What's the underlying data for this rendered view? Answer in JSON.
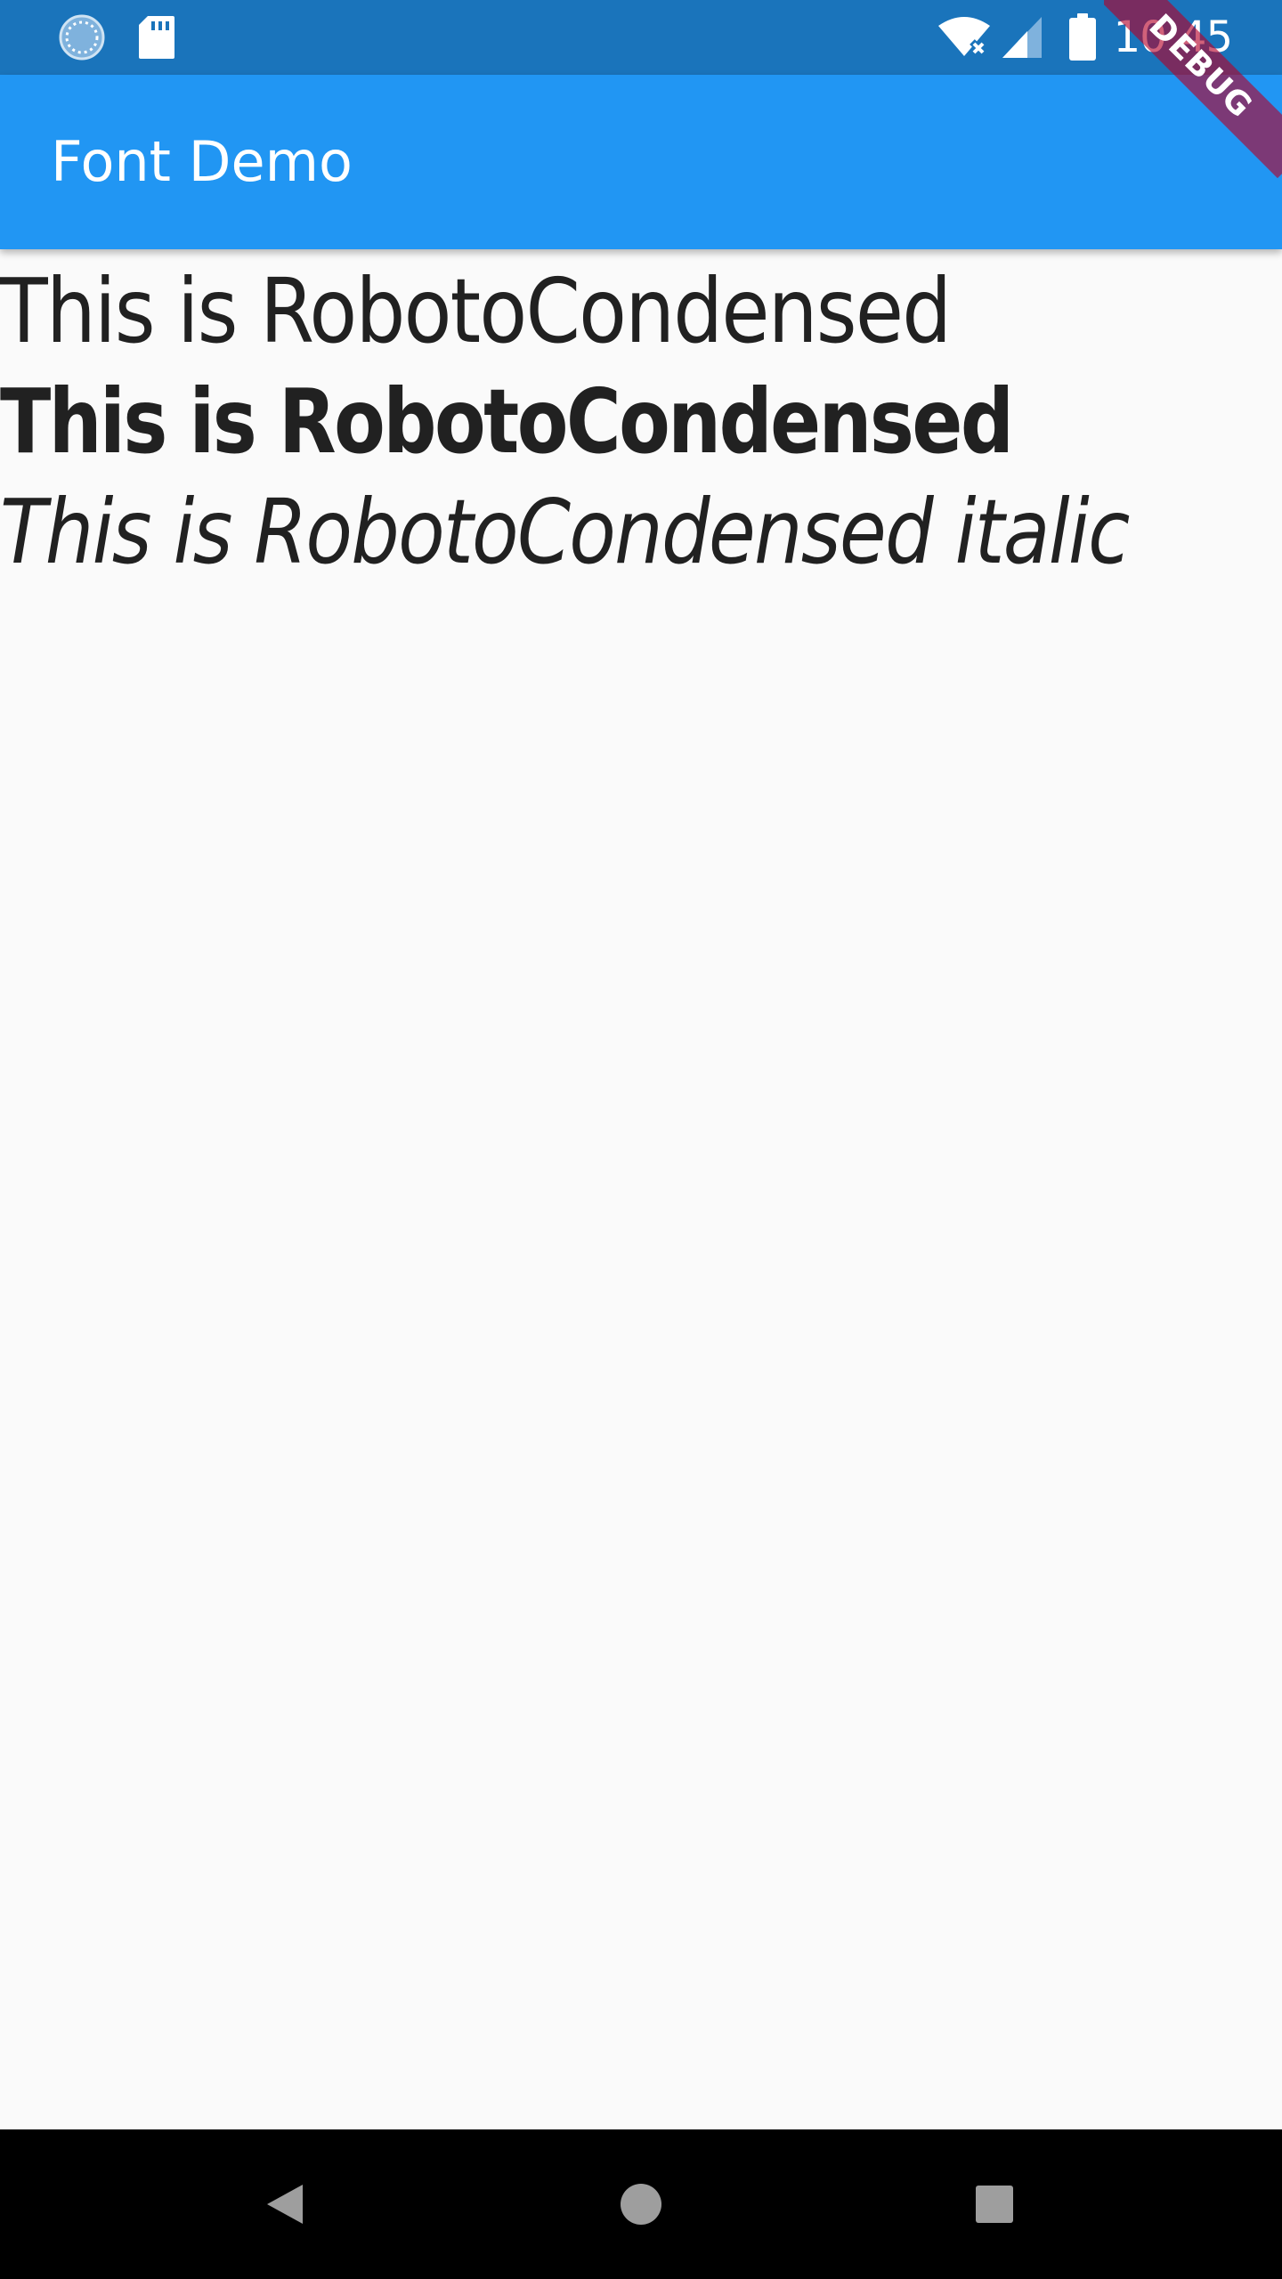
{
  "status_bar": {
    "time": "10:45",
    "left_icons": [
      "sync-icon",
      "sd-card-icon"
    ],
    "right_icons": [
      "wifi-off-icon",
      "signal-icon",
      "battery-icon"
    ],
    "background": "#1a74bb"
  },
  "app_bar": {
    "title": "Font Demo",
    "background": "#2196f3"
  },
  "content": {
    "lines": [
      {
        "text": "This is RobotoCondensed",
        "style": "regular"
      },
      {
        "text": "This is RobotoCondensed",
        "style": "bold"
      },
      {
        "text": "This is RobotoCondensed italic",
        "style": "italic"
      }
    ],
    "text_color": "#212121",
    "background": "#fafafa"
  },
  "nav_bar": {
    "buttons": [
      "back-icon",
      "home-icon",
      "recents-icon"
    ],
    "background": "#000000"
  },
  "debug_banner": {
    "label": "DEBUG"
  }
}
